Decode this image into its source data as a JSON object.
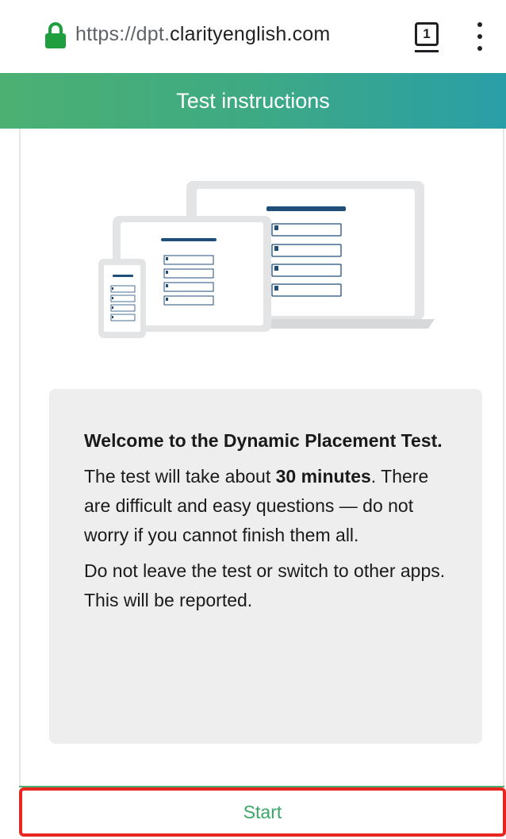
{
  "browser": {
    "url_prefix": "https://dpt.",
    "url_domain": "clarityenglish.com",
    "tab_count": "1",
    "lock_icon": "lock-icon",
    "menu_icon": "more-vert-icon"
  },
  "header": {
    "title": "Test instructions"
  },
  "info": {
    "title": "Welcome to the Dynamic Placement Test.",
    "p1_before": "The test will take about ",
    "p1_bold": "30 minutes",
    "p1_after": ".",
    "p2": "There are difficult and easy questions — do not worry if you cannot finish them all.",
    "p3": "Do not leave the test or switch to other apps. This will be reported."
  },
  "actions": {
    "start_label": "Start"
  },
  "colors": {
    "accent_green": "#4cb072",
    "accent_teal": "#2a9ea7",
    "highlight_red": "#e8251f",
    "illustration_blue": "#1f4e79"
  }
}
